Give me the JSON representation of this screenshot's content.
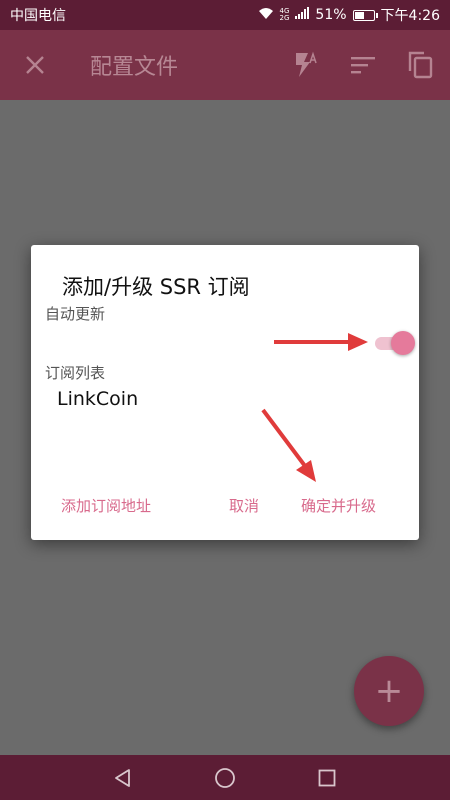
{
  "status_bar": {
    "carrier": "中国电信",
    "network_top": "4G",
    "network_bottom": "2G",
    "battery_percent": "51%",
    "battery_level": 0.51,
    "time": "下午4:26",
    "icons": [
      "wifi-icon",
      "signal-icon",
      "battery-icon"
    ]
  },
  "app_bar": {
    "title": "配置文件",
    "icons": [
      "close-icon",
      "flash-auto-icon",
      "sort-icon",
      "copy-icon"
    ]
  },
  "dialog": {
    "title": "添加/升级 SSR 订阅",
    "auto_update_label": "自动更新",
    "auto_update_on": true,
    "list_label": "订阅列表",
    "subscriptions": [
      "LinkCoin"
    ],
    "buttons": {
      "add_url": "添加订阅地址",
      "cancel": "取消",
      "confirm_upgrade": "确定并升级"
    }
  },
  "fab": {
    "label": "+"
  },
  "nav_bar": {
    "icons": [
      "back-icon",
      "home-icon",
      "recents-icon"
    ]
  },
  "colors": {
    "status_bar": "#5c1d35",
    "app_bar": "#7a3248",
    "accent": "#d86a8c",
    "toggle_thumb": "#e57a9b",
    "arrow": "#e03b3b",
    "scrim": "#6b6b6b"
  }
}
